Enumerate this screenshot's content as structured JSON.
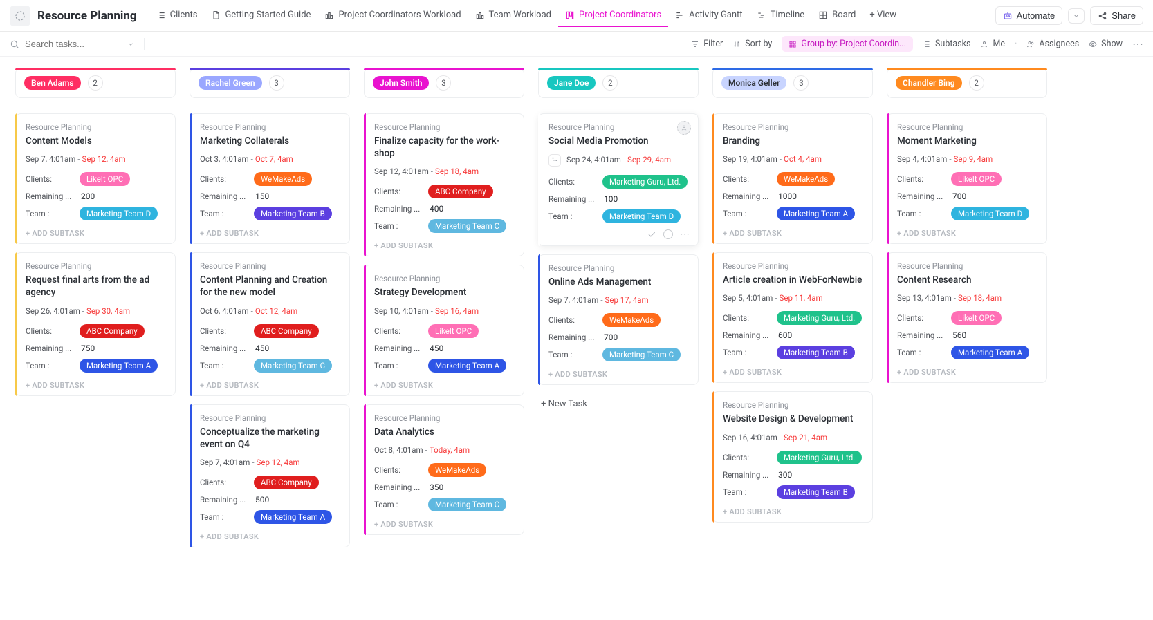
{
  "header": {
    "title": "Resource Planning",
    "tabs": [
      {
        "label": "Clients"
      },
      {
        "label": "Getting Started Guide"
      },
      {
        "label": "Project Coordinators Workload"
      },
      {
        "label": "Team Workload"
      },
      {
        "label": "Project Coordinators",
        "active": true
      },
      {
        "label": "Activity Gantt"
      },
      {
        "label": "Timeline"
      },
      {
        "label": "Board"
      },
      {
        "label": "+ View"
      }
    ],
    "automate": "Automate",
    "share": "Share"
  },
  "toolbar": {
    "search_placeholder": "Search tasks...",
    "filter": "Filter",
    "sort": "Sort by",
    "group": "Group by: Project Coordin...",
    "subtasks": "Subtasks",
    "me": "Me",
    "assignees": "Assignees",
    "show": "Show"
  },
  "labels": {
    "breadcrumb": "Resource Planning",
    "clients": "Clients:",
    "remaining": "Remaining ...",
    "team": "Team :",
    "add_subtask": "+ ADD SUBTASK",
    "new_task": "+ New Task"
  },
  "clients_palette": {
    "LikeIt OPC": "#ff6fb5",
    "WeMakeAds": "#ff6b1a",
    "ABC Company": "#e01e1e",
    "Marketing Guru, Ltd.": "#1fc28b"
  },
  "teams_palette": {
    "Marketing Team A": "#2e55e6",
    "Marketing Team B": "#5b3fe0",
    "Marketing Team C": "#5fb8e0",
    "Marketing Team D": "#2fb4df"
  },
  "columns": [
    {
      "name": "Ben Adams",
      "count": "2",
      "accent": "#ff2e63",
      "chip": "#ff2e63",
      "cards": [
        {
          "stripe": "#f7c948",
          "title": "Content Models",
          "start": "Sep 7, 4:01am",
          "due": "Sep 12, 4am",
          "client": "LikeIt OPC",
          "remaining": "200",
          "team": "Marketing Team D"
        },
        {
          "stripe": "#f7c948",
          "title": "Request final arts from the ad agency",
          "start": "Sep 26, 4:01am",
          "due": "Sep 30, 4am",
          "client": "ABC Company",
          "remaining": "750",
          "team": "Marketing Team A"
        }
      ]
    },
    {
      "name": "Rachel Green",
      "count": "3",
      "accent": "#5b3fe0",
      "chip": "#9aa7ff",
      "cards": [
        {
          "stripe": "#2e55e6",
          "title": "Marketing Collaterals",
          "start": "Oct 3, 4:01am",
          "due": "Oct 7, 4am",
          "client": "WeMakeAds",
          "remaining": "150",
          "team": "Marketing Team B"
        },
        {
          "stripe": "#2e55e6",
          "title": "Content Planning and Creation for the new model",
          "start": "Oct 6, 4:01am",
          "due": "Oct 12, 4am",
          "client": "ABC Company",
          "remaining": "450",
          "team": "Marketing Team C"
        },
        {
          "stripe": "#2e55e6",
          "title": "Conceptualize the marketing event on Q4",
          "start": "Sep 7, 4:01am",
          "due": "Sep 12, 4am",
          "client": "ABC Company",
          "remaining": "500",
          "team": "Marketing Team A"
        }
      ]
    },
    {
      "name": "John Smith",
      "count": "3",
      "accent": "#e913cf",
      "chip": "#e913cf",
      "cards": [
        {
          "stripe": "#e913cf",
          "title": "Finalize capacity for the work­shop",
          "start": "Sep 12, 4:01am",
          "due": "Sep 18, 4am",
          "client": "ABC Company",
          "remaining": "400",
          "team": "Marketing Team C"
        },
        {
          "stripe": "#e913cf",
          "title": "Strategy Development",
          "start": "Sep 10, 4:01am",
          "due": "Sep 16, 4am",
          "client": "LikeIt OPC",
          "remaining": "450",
          "team": "Marketing Team A"
        },
        {
          "stripe": "#e913cf",
          "title": "Data Analytics",
          "start": "Oct 8, 4:01am",
          "due": "Today, 4am",
          "client": "WeMakeAds",
          "remaining": "350",
          "team": "Marketing Team C"
        }
      ]
    },
    {
      "name": "Jane Doe",
      "count": "2",
      "accent": "#18c7c0",
      "chip": "#18c7c0",
      "cards": [
        {
          "stripe": "#ffffff",
          "title": "Social Media Promotion",
          "start": "Sep 24, 4:01am",
          "due": "Sep 29, 4am",
          "client": "Marketing Guru, Ltd.",
          "remaining": "100",
          "team": "Marketing Team D",
          "hovered": true,
          "show_avatar": true,
          "show_mini_icon": true,
          "show_footer": true
        },
        {
          "stripe": "#2e55e6",
          "title": "Online Ads Management",
          "start": "Sep 7, 4:01am",
          "due": "Sep 17, 4am",
          "client": "WeMakeAds",
          "remaining": "700",
          "team": "Marketing Team C"
        }
      ],
      "show_new_task": true
    },
    {
      "name": "Monica Geller",
      "count": "3",
      "accent": "#2e6be6",
      "chip": "#c8d4ff",
      "chip_text": "#2a2e34",
      "cards": [
        {
          "stripe": "#ff8a1f",
          "title": "Branding",
          "start": "Sep 19, 4:01am",
          "due": "Oct 4, 4am",
          "client": "WeMakeAds",
          "remaining": "1000",
          "team": "Marketing Team A"
        },
        {
          "stripe": "#ff8a1f",
          "title": "Article creation in WebForNewbie",
          "start": "Sep 5, 4:01am",
          "due": "Sep 11, 4am",
          "client": "Marketing Guru, Ltd.",
          "remaining": "600",
          "team": "Marketing Team B"
        },
        {
          "stripe": "#ff8a1f",
          "title": "Website Design & Development",
          "start": "Sep 16, 4:01am",
          "due": "Sep 21, 4am",
          "client": "Marketing Guru, Ltd.",
          "remaining": "300",
          "team": "Marketing Team B"
        }
      ]
    },
    {
      "name": "Chandler Bing",
      "count": "2",
      "accent": "#ff8a1f",
      "chip": "#ff8a1f",
      "cards": [
        {
          "stripe": "#e913cf",
          "title": "Moment Marketing",
          "start": "Sep 4, 4:01am",
          "due": "Sep 9, 4am",
          "client": "LikeIt OPC",
          "remaining": "700",
          "team": "Marketing Team D"
        },
        {
          "stripe": "#e913cf",
          "title": "Content Research",
          "start": "Sep 13, 4:01am",
          "due": "Sep 18, 4am",
          "client": "LikeIt OPC",
          "remaining": "560",
          "team": "Marketing Team A"
        }
      ]
    }
  ]
}
